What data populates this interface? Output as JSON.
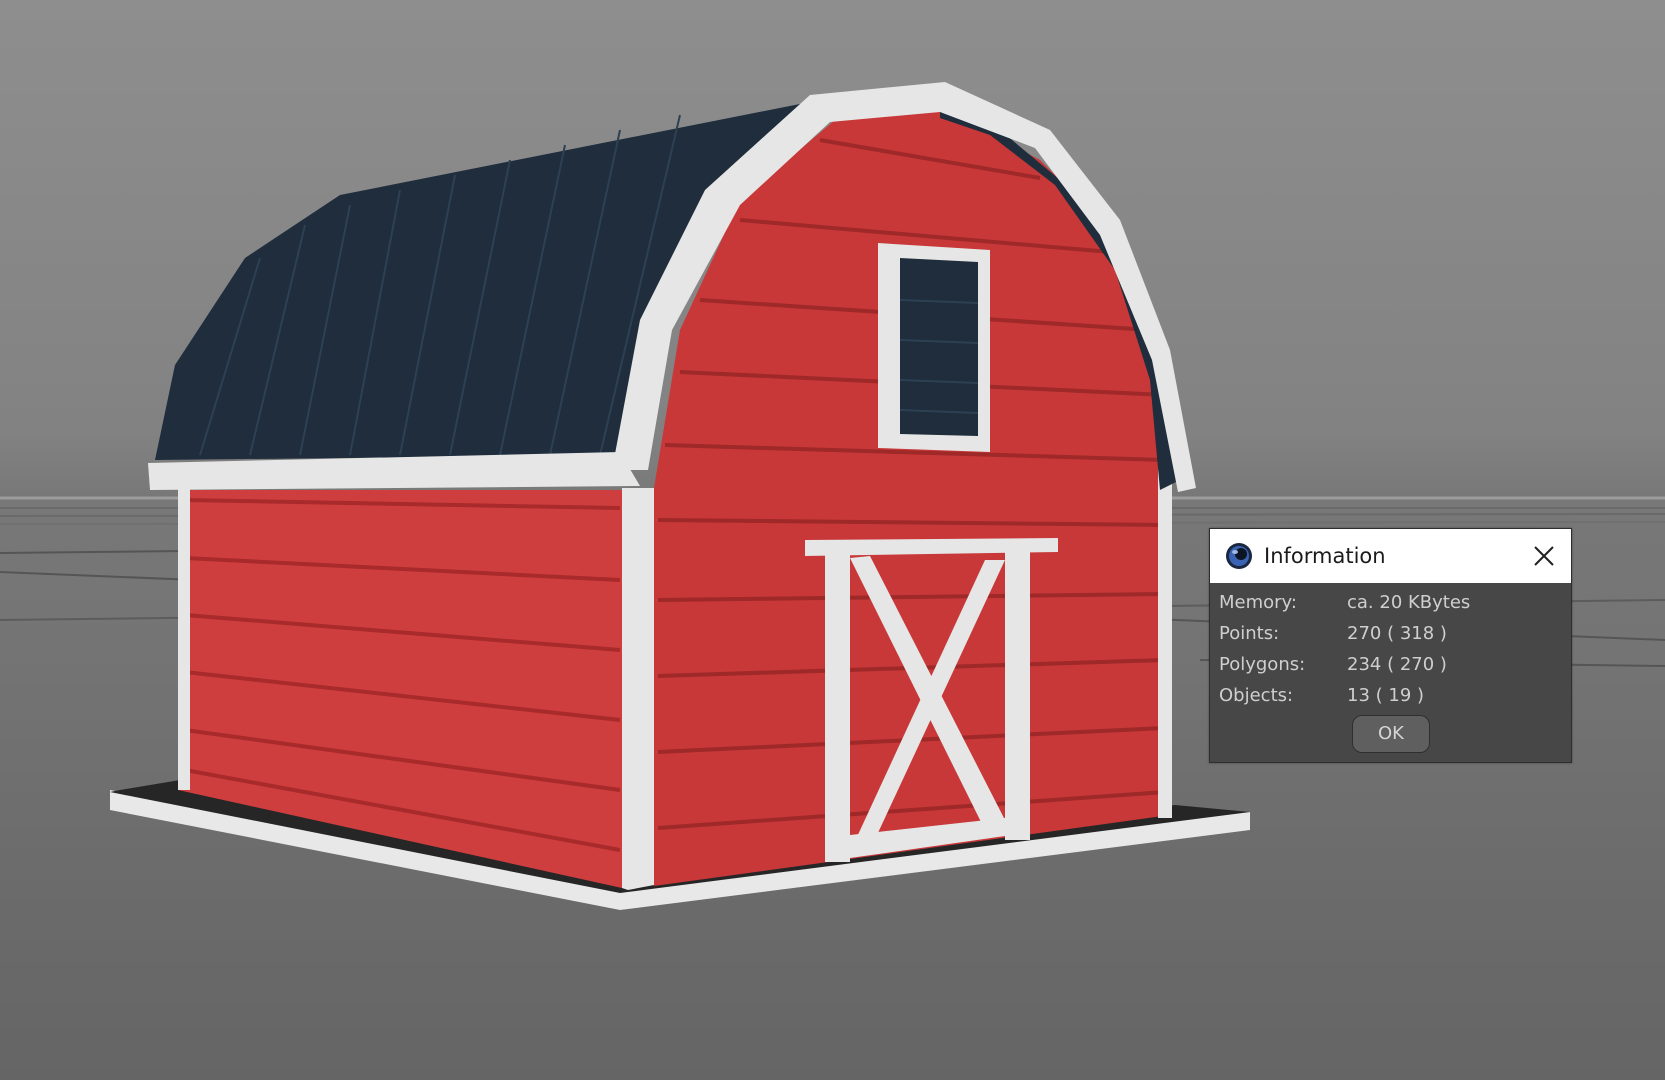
{
  "viewport": {
    "description_icon": "barn-3d-model",
    "colors": {
      "barn_red": "#cf3d3d",
      "roof_navy": "#1f2d3c",
      "trim_white": "#e6e6e6",
      "background_gray": "#7a7a7a"
    }
  },
  "dialog": {
    "title": "Information",
    "app_icon": "cinema4d-logo-icon",
    "close_icon": "close-icon",
    "rows": [
      {
        "label": "Memory:",
        "value": "ca. 20 KBytes"
      },
      {
        "label": "Points:",
        "value": "270 ( 318 )"
      },
      {
        "label": "Polygons:",
        "value": "234 ( 270 )"
      },
      {
        "label": "Objects:",
        "value": "13 ( 19 )"
      }
    ],
    "ok_label": "OK"
  }
}
